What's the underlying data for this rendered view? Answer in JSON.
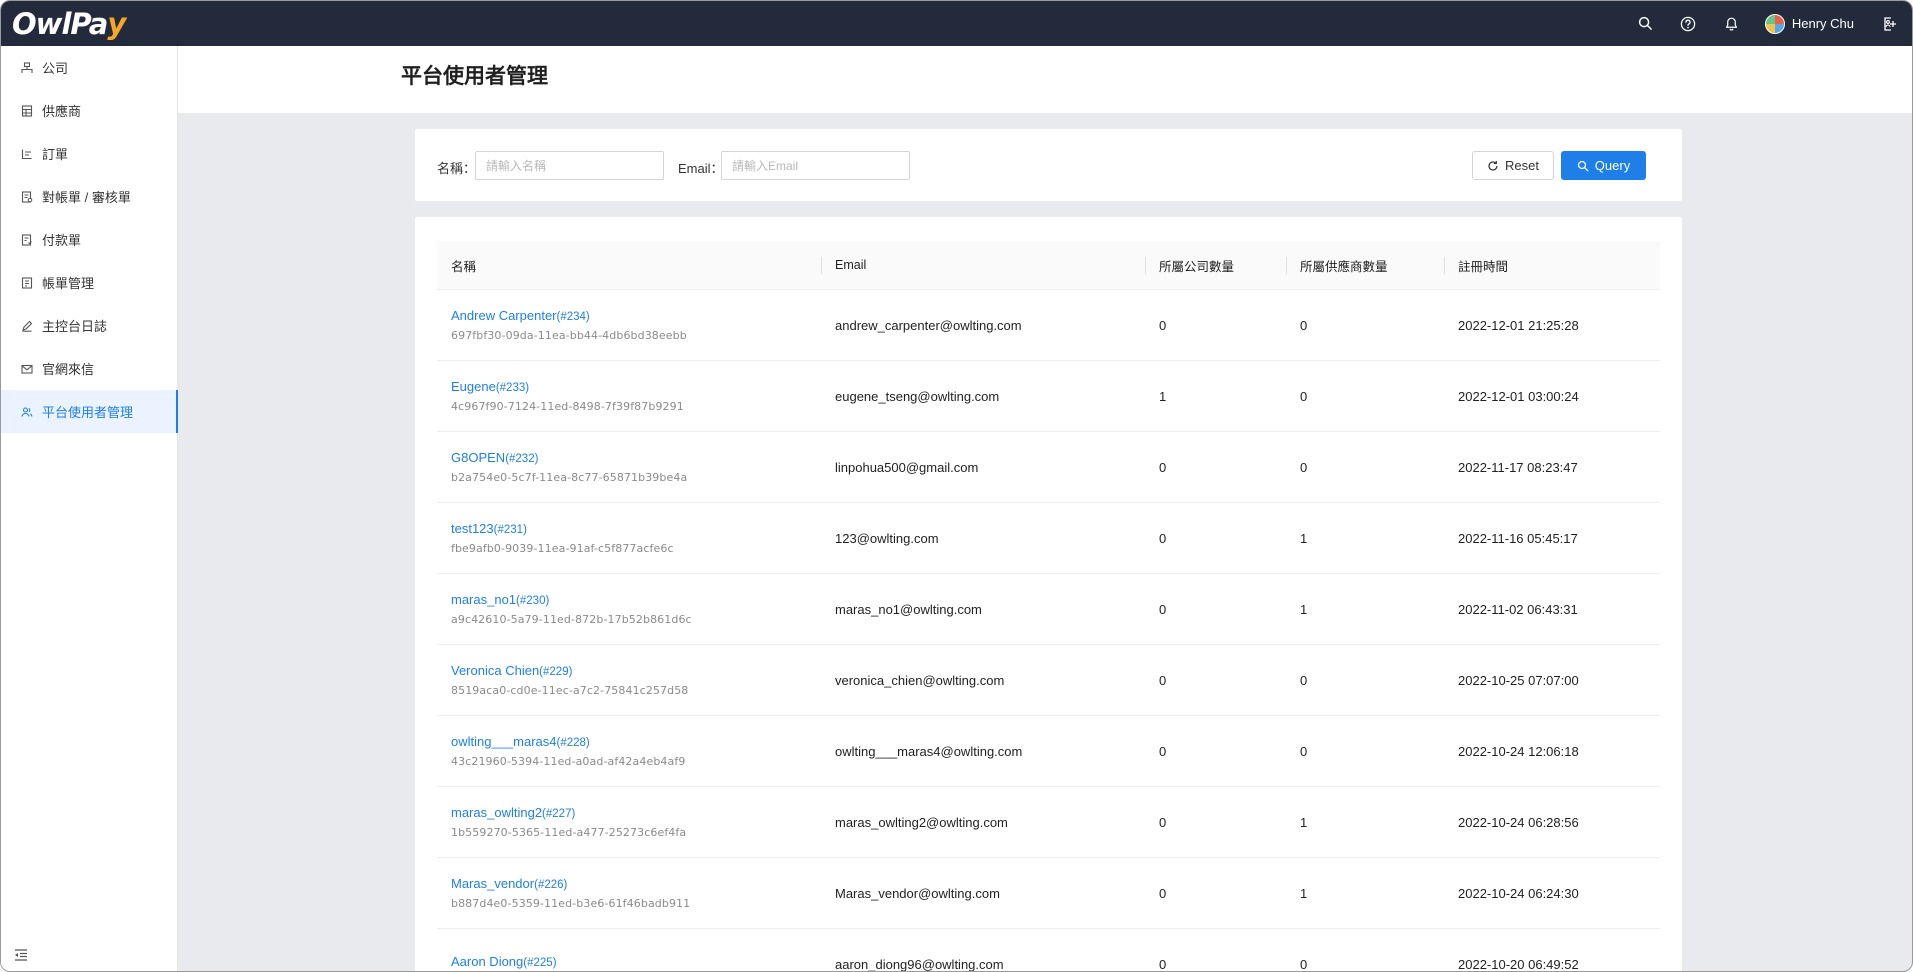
{
  "app": {
    "logo_main": "OwlPa",
    "logo_accent": "y"
  },
  "topbar": {
    "icons": [
      "search-icon",
      "help-icon",
      "bell-icon"
    ],
    "user_name": "Henry Chu",
    "logout_icon": "logout-icon"
  },
  "sidebar": {
    "items": [
      {
        "label": "公司",
        "icon": "company-icon"
      },
      {
        "label": "供應商",
        "icon": "vendor-icon"
      },
      {
        "label": "訂單",
        "icon": "order-icon"
      },
      {
        "label": "對帳單 / 審核單",
        "icon": "statement-icon"
      },
      {
        "label": "付款單",
        "icon": "payment-icon"
      },
      {
        "label": "帳單管理",
        "icon": "bill-icon"
      },
      {
        "label": "主控台日誌",
        "icon": "log-icon"
      },
      {
        "label": "官網來信",
        "icon": "mail-icon"
      },
      {
        "label": "平台使用者管理",
        "icon": "users-icon",
        "active": true
      }
    ]
  },
  "page": {
    "title": "平台使用者管理"
  },
  "filter": {
    "name_label": "名稱：",
    "name_placeholder": "請輸入名稱",
    "email_label": "Email：",
    "email_placeholder": "請輸入Email",
    "reset_label": "Reset",
    "query_label": "Query"
  },
  "table": {
    "columns": [
      "名稱",
      "Email",
      "所屬公司數量",
      "所屬供應商數量",
      "註冊時間"
    ],
    "rows": [
      {
        "name": "Andrew Carpenter",
        "id": "(#234)",
        "uuid": "697fbf30-09da-11ea-bb44-4db6bd38eebb",
        "email": "andrew_carpenter@owlting.com",
        "companies": "0",
        "vendors": "0",
        "registered": "2022-12-01 21:25:28"
      },
      {
        "name": "Eugene",
        "id": "(#233)",
        "uuid": "4c967f90-7124-11ed-8498-7f39f87b9291",
        "email": "eugene_tseng@owlting.com",
        "companies": "1",
        "vendors": "0",
        "registered": "2022-12-01 03:00:24"
      },
      {
        "name": "G8OPEN",
        "id": "(#232)",
        "uuid": "b2a754e0-5c7f-11ea-8c77-65871b39be4a",
        "email": "linpohua500@gmail.com",
        "companies": "0",
        "vendors": "0",
        "registered": "2022-11-17 08:23:47"
      },
      {
        "name": "test123",
        "id": "(#231)",
        "uuid": "fbe9afb0-9039-11ea-91af-c5f877acfe6c",
        "email": "123@owlting.com",
        "companies": "0",
        "vendors": "1",
        "registered": "2022-11-16 05:45:17"
      },
      {
        "name": "maras_no1",
        "id": "(#230)",
        "uuid": "a9c42610-5a79-11ed-872b-17b52b861d6c",
        "email": "maras_no1@owlting.com",
        "companies": "0",
        "vendors": "1",
        "registered": "2022-11-02 06:43:31"
      },
      {
        "name": "Veronica Chien",
        "id": "(#229)",
        "uuid": "8519aca0-cd0e-11ec-a7c2-75841c257d58",
        "email": "veronica_chien@owlting.com",
        "companies": "0",
        "vendors": "0",
        "registered": "2022-10-25 07:07:00"
      },
      {
        "name": "owlting___maras4",
        "id": "(#228)",
        "uuid": "43c21960-5394-11ed-a0ad-af42a4eb4af9",
        "email": "owlting___maras4@owlting.com",
        "companies": "0",
        "vendors": "0",
        "registered": "2022-10-24 12:06:18"
      },
      {
        "name": "maras_owlting2",
        "id": "(#227)",
        "uuid": "1b559270-5365-11ed-a477-25273c6ef4fa",
        "email": "maras_owlting2@owlting.com",
        "companies": "0",
        "vendors": "1",
        "registered": "2022-10-24 06:28:56"
      },
      {
        "name": "Maras_vendor",
        "id": "(#226)",
        "uuid": "b887d4e0-5359-11ed-b3e6-61f46badb911",
        "email": "Maras_vendor@owlting.com",
        "companies": "0",
        "vendors": "1",
        "registered": "2022-10-24 06:24:30"
      },
      {
        "name": "Aaron Diong",
        "id": "(#225)",
        "uuid": "",
        "email": "aaron_diong96@owlting.com",
        "companies": "0",
        "vendors": "0",
        "registered": "2022-10-20 06:49:52"
      }
    ]
  }
}
